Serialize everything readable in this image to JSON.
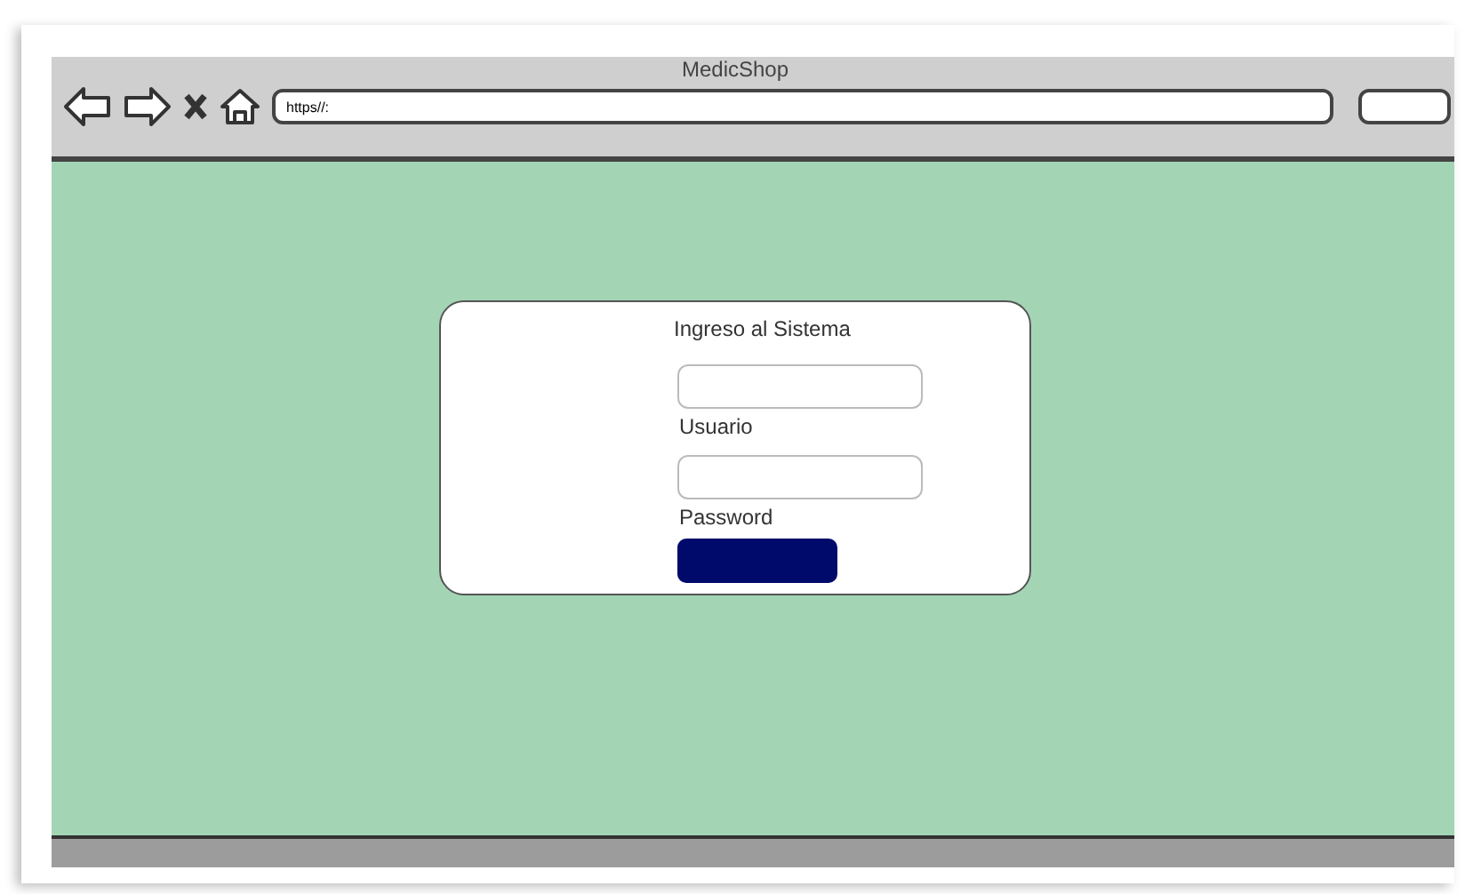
{
  "window": {
    "title": "MedicShop"
  },
  "address_bar": {
    "value": "https//:"
  },
  "login": {
    "title": "Ingreso al Sistema",
    "fields": [
      {
        "label": "Usuario"
      },
      {
        "label": "Password"
      }
    ]
  }
}
